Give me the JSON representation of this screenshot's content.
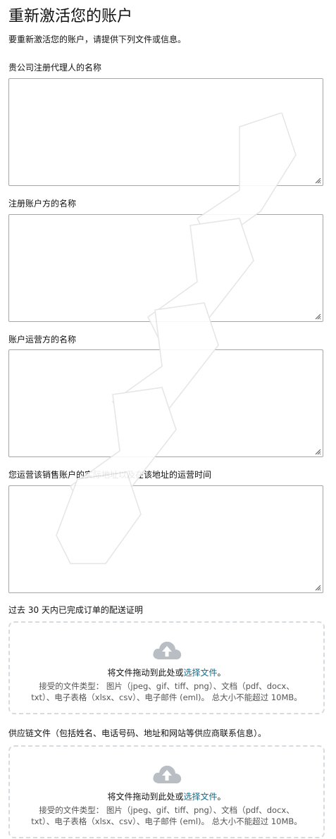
{
  "page": {
    "title": "重新激活您的账户",
    "intro": "要重新激活您的账户，请提供下列文件或信息。"
  },
  "fields": [
    {
      "label": "贵公司注册代理人的名称",
      "value": ""
    },
    {
      "label": "注册账户方的名称",
      "value": ""
    },
    {
      "label": "账户运营方的名称",
      "value": ""
    },
    {
      "label": "您运营该销售账户的实际地址以及在该地址的运营时间",
      "value": ""
    }
  ],
  "uploads": [
    {
      "label": "过去 30 天内已完成订单的配送证明",
      "drag_text": "将文件拖动到此处或",
      "link_text": "选择文件",
      "end_punct": "。",
      "types_line1": "接受的文件类型：  图片（jpeg、gif、tiff、png）、文档（pdf、docx、",
      "types_line2": "txt）、电子表格（xlsx、csv）、电子邮件 (eml)。 总大小不能超过 10MB。"
    },
    {
      "label": "供应链文件（包括姓名、电话号码、地址和网站等供应商联系信息）。",
      "drag_text": "将文件拖动到此处或",
      "link_text": "选择文件",
      "end_punct": "。",
      "types_line1": "接受的文件类型：  图片（jpeg、gif、tiff、png）、文档（pdf、docx、",
      "types_line2": "txt）、电子表格（xlsx、csv）、电子邮件 (eml)。 总大小不能超过 10MB。"
    }
  ],
  "colors": {
    "link": "#0a6d8c",
    "border": "#a6a6a6",
    "dashed": "#d6dbdf",
    "icon": "#b9bec4"
  },
  "icons": {
    "upload": "cloud-upload-icon",
    "resize": "resize-handle-icon"
  }
}
